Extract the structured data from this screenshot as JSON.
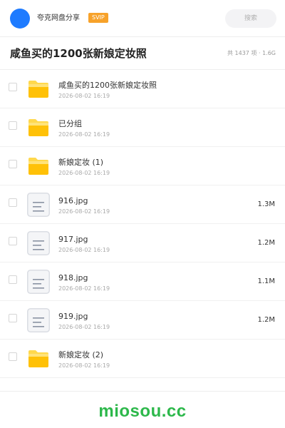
{
  "header": {
    "site_name": "夸克网盘分享",
    "badge": "SVIP",
    "search_placeholder": "搜索",
    "avatar_color": "#1e7bff",
    "badge_color": "#f7a22a"
  },
  "folder": {
    "title": "咸鱼买的1200张新娘定妆照",
    "summary": "共 1437 项 · 1.6G"
  },
  "files": [
    {
      "type": "folder",
      "icon": "folder-icon",
      "name": "咸鱼买的1200张新娘定妆照",
      "date": "2026-08-02 16:19",
      "size": ""
    },
    {
      "type": "folder",
      "icon": "folder-icon",
      "name": "已分组",
      "date": "2026-08-02 16:19",
      "size": ""
    },
    {
      "type": "folder",
      "icon": "folder-icon",
      "name": "新娘定妆 (1)",
      "date": "2026-08-02 16:19",
      "size": ""
    },
    {
      "type": "file",
      "icon": "document-icon",
      "name": "916.jpg",
      "date": "2026-08-02 16:19",
      "size": "1.3M"
    },
    {
      "type": "file",
      "icon": "document-icon",
      "name": "917.jpg",
      "date": "2026-08-02 16:19",
      "size": "1.2M"
    },
    {
      "type": "file",
      "icon": "document-icon",
      "name": "918.jpg",
      "date": "2026-08-02 16:19",
      "size": "1.1M"
    },
    {
      "type": "file",
      "icon": "document-icon",
      "name": "919.jpg",
      "date": "2026-08-02 16:19",
      "size": "1.2M"
    },
    {
      "type": "folder",
      "icon": "folder-icon",
      "name": "新娘定妆 (2)",
      "date": "2026-08-02 16:19",
      "size": ""
    }
  ],
  "footer": {
    "watermark": "miosou.cc",
    "watermark_color": "#2db84b"
  }
}
